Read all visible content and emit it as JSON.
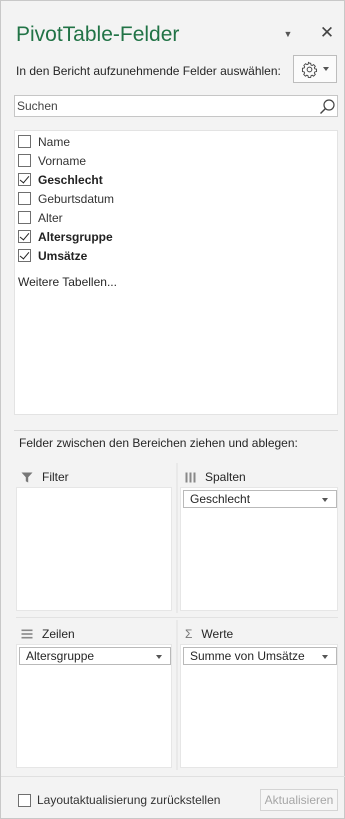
{
  "header": {
    "title": "PivotTable-Felder",
    "subtitle": "In den Bericht aufzunehmende Felder auswählen:",
    "title_color": "#217346",
    "close_glyph": "✕",
    "dropdown_glyph": "▼"
  },
  "search": {
    "placeholder": "Suchen"
  },
  "fields": [
    {
      "label": "Name",
      "checked": false
    },
    {
      "label": "Vorname",
      "checked": false
    },
    {
      "label": "Geschlecht",
      "checked": true
    },
    {
      "label": "Geburtsdatum",
      "checked": false
    },
    {
      "label": "Alter",
      "checked": false
    },
    {
      "label": "Altersgruppe",
      "checked": true
    },
    {
      "label": "Umsätze",
      "checked": true
    }
  ],
  "more_tables": "Weitere Tabellen...",
  "drag_hint": "Felder zwischen den Bereichen ziehen und ablegen:",
  "areas": {
    "filter": {
      "label": "Filter",
      "items": []
    },
    "columns": {
      "label": "Spalten",
      "items": [
        "Geschlecht"
      ]
    },
    "rows": {
      "label": "Zeilen",
      "items": [
        "Altersgruppe"
      ]
    },
    "values": {
      "label": "Werte",
      "items": [
        "Summe von Umsätze"
      ]
    }
  },
  "footer": {
    "defer_label": "Layoutaktualisierung zurückstellen",
    "defer_checked": false,
    "update_button": "Aktualisieren"
  },
  "icons": {
    "settings": "gear-icon",
    "search": "search-icon",
    "filter": "filter-funnel-icon",
    "columns": "columns-icon",
    "rows": "rows-icon",
    "values": "sigma-icon"
  }
}
